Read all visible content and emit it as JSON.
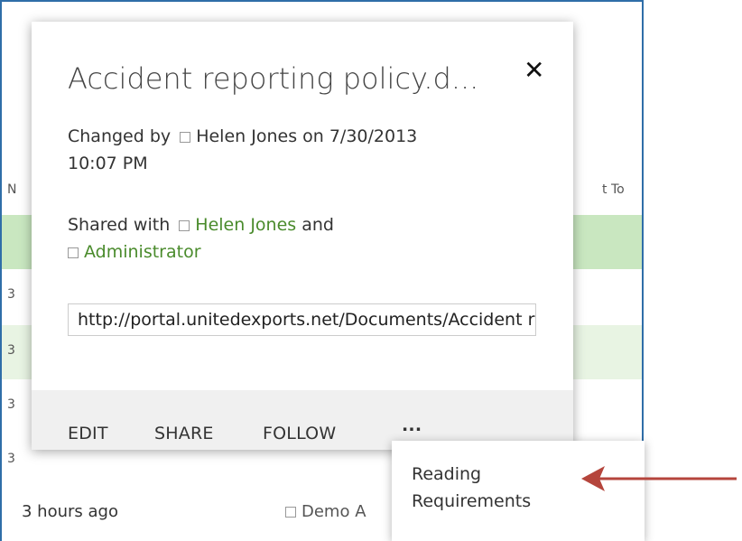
{
  "background": {
    "column_header_left": "N",
    "column_header_right": "t To",
    "row_edge_labels": [
      "3",
      "3",
      "3",
      "3"
    ],
    "bottom_row": {
      "time": "3 hours ago",
      "owner": "Demo A"
    }
  },
  "callout": {
    "title": "Accident reporting policy.d...",
    "close_label": "✕",
    "changed_prefix": "Changed by",
    "changed_user": "Helen Jones",
    "changed_on": "on 7/30/2013",
    "changed_time": "10:07 PM",
    "shared_prefix": "Shared with",
    "shared_user_1": "Helen Jones",
    "shared_and": "and",
    "shared_user_2": "Administrator",
    "url": "http://portal.unitedexports.net/Documents/Accident reporting policy.docx",
    "actions": {
      "edit": "EDIT",
      "share": "SHARE",
      "follow": "FOLLOW",
      "more": "..."
    }
  },
  "menu": {
    "item_1": "Reading Requirements"
  },
  "colors": {
    "frame_border": "#2f6ea8",
    "selected_row": "#c9e7c0",
    "alt_row": "#e8f4e3",
    "link": "#4a8b2c",
    "arrow": "#b5453c"
  }
}
